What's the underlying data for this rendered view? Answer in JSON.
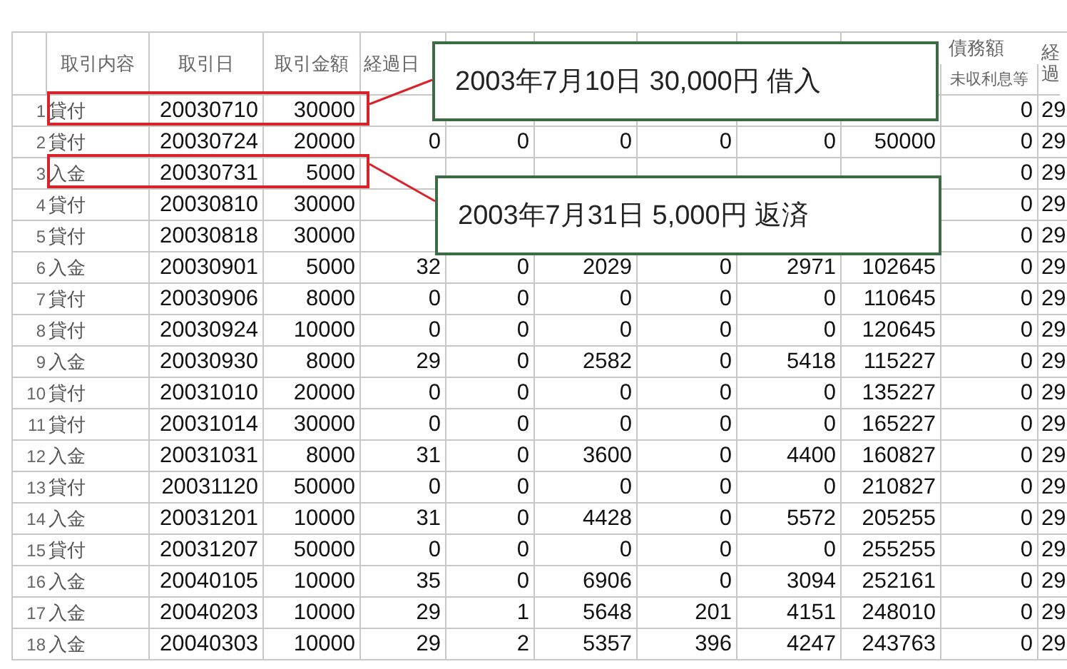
{
  "columns": [
    {
      "label": "取引内容"
    },
    {
      "label": "取引日"
    },
    {
      "label": "取引金額"
    },
    {
      "label": "経過日"
    },
    {},
    {},
    {},
    {},
    {},
    {
      "label": "未収利息等"
    },
    {
      "label": "経過"
    }
  ],
  "group_header": {
    "label": "債務額"
  },
  "rows": [
    {
      "number": "1",
      "transaction_type": "貸付",
      "date": "20030710",
      "amount": "30000",
      "column_10": "0",
      "column_11": "29",
      "highlighted": true,
      "callout": "2003年7月10日 30,000円 借入"
    },
    {
      "number": "2",
      "transaction_type": "貸付",
      "date": "20030724",
      "amount": "20000",
      "column_4": "0",
      "column_5": "0",
      "column_6": "0",
      "column_7": "0",
      "column_8": "0",
      "column_9": "50000",
      "column_10": "0",
      "column_11": "29",
      "highlighted": false
    },
    {
      "number": "3",
      "transaction_type": "入金",
      "date": "20030731",
      "amount": "5000",
      "column_10": "0",
      "column_11": "29",
      "highlighted": true,
      "callout": "2003年7月31日 5,000円 返済"
    },
    {
      "number": "4",
      "transaction_type": "貸付",
      "date": "20030810",
      "amount": "30000",
      "column_10": "0",
      "column_11": "29",
      "highlighted": false
    },
    {
      "number": "5",
      "transaction_type": "貸付",
      "date": "20030818",
      "amount": "30000",
      "column_10": "0",
      "column_11": "29",
      "highlighted": false
    },
    {
      "number": "6",
      "transaction_type": "入金",
      "date": "20030901",
      "amount": "5000",
      "column_4": "32",
      "column_5": "0",
      "column_6": "2029",
      "column_7": "0",
      "column_8": "2971",
      "column_9": "102645",
      "column_10": "0",
      "column_11": "29",
      "highlighted": false
    },
    {
      "number": "7",
      "transaction_type": "貸付",
      "date": "20030906",
      "amount": "8000",
      "column_4": "0",
      "column_5": "0",
      "column_6": "0",
      "column_7": "0",
      "column_8": "0",
      "column_9": "110645",
      "column_10": "0",
      "column_11": "29",
      "highlighted": false
    },
    {
      "number": "8",
      "transaction_type": "貸付",
      "date": "20030924",
      "amount": "10000",
      "column_4": "0",
      "column_5": "0",
      "column_6": "0",
      "column_7": "0",
      "column_8": "0",
      "column_9": "120645",
      "column_10": "0",
      "column_11": "29",
      "highlighted": false
    },
    {
      "number": "9",
      "transaction_type": "入金",
      "date": "20030930",
      "amount": "8000",
      "column_4": "29",
      "column_5": "0",
      "column_6": "2582",
      "column_7": "0",
      "column_8": "5418",
      "column_9": "115227",
      "column_10": "0",
      "column_11": "29",
      "highlighted": false
    },
    {
      "number": "10",
      "transaction_type": "貸付",
      "date": "20031010",
      "amount": "20000",
      "column_4": "0",
      "column_5": "0",
      "column_6": "0",
      "column_7": "0",
      "column_8": "0",
      "column_9": "135227",
      "column_10": "0",
      "column_11": "29",
      "highlighted": false
    },
    {
      "number": "11",
      "transaction_type": "貸付",
      "date": "20031014",
      "amount": "30000",
      "column_4": "0",
      "column_5": "0",
      "column_6": "0",
      "column_7": "0",
      "column_8": "0",
      "column_9": "165227",
      "column_10": "0",
      "column_11": "29",
      "highlighted": false
    },
    {
      "number": "12",
      "transaction_type": "入金",
      "date": "20031031",
      "amount": "8000",
      "column_4": "31",
      "column_5": "0",
      "column_6": "3600",
      "column_7": "0",
      "column_8": "4400",
      "column_9": "160827",
      "column_10": "0",
      "column_11": "29",
      "highlighted": false
    },
    {
      "number": "13",
      "transaction_type": "貸付",
      "date": "20031120",
      "amount": "50000",
      "column_4": "0",
      "column_5": "0",
      "column_6": "0",
      "column_7": "0",
      "column_8": "0",
      "column_9": "210827",
      "column_10": "0",
      "column_11": "29",
      "highlighted": false
    },
    {
      "number": "14",
      "transaction_type": "入金",
      "date": "20031201",
      "amount": "10000",
      "column_4": "31",
      "column_5": "0",
      "column_6": "4428",
      "column_7": "0",
      "column_8": "5572",
      "column_9": "205255",
      "column_10": "0",
      "column_11": "29",
      "highlighted": false
    },
    {
      "number": "15",
      "transaction_type": "貸付",
      "date": "20031207",
      "amount": "50000",
      "column_4": "0",
      "column_5": "0",
      "column_6": "0",
      "column_7": "0",
      "column_8": "0",
      "column_9": "255255",
      "column_10": "0",
      "column_11": "29",
      "highlighted": false
    },
    {
      "number": "16",
      "transaction_type": "入金",
      "date": "20040105",
      "amount": "10000",
      "column_4": "35",
      "column_5": "0",
      "column_6": "6906",
      "column_7": "0",
      "column_8": "3094",
      "column_9": "252161",
      "column_10": "0",
      "column_11": "29",
      "highlighted": false
    },
    {
      "number": "17",
      "transaction_type": "入金",
      "date": "20040203",
      "amount": "10000",
      "column_4": "29",
      "column_5": "1",
      "column_6": "5648",
      "column_7": "201",
      "column_8": "4151",
      "column_9": "248010",
      "column_10": "0",
      "column_11": "29",
      "highlighted": false
    },
    {
      "number": "18",
      "transaction_type": "入金",
      "date": "20040303",
      "amount": "10000",
      "column_4": "29",
      "column_5": "2",
      "column_6": "5357",
      "column_7": "396",
      "column_8": "4247",
      "column_9": "243763",
      "column_10": "0",
      "column_11": "29",
      "highlighted": false
    }
  ]
}
